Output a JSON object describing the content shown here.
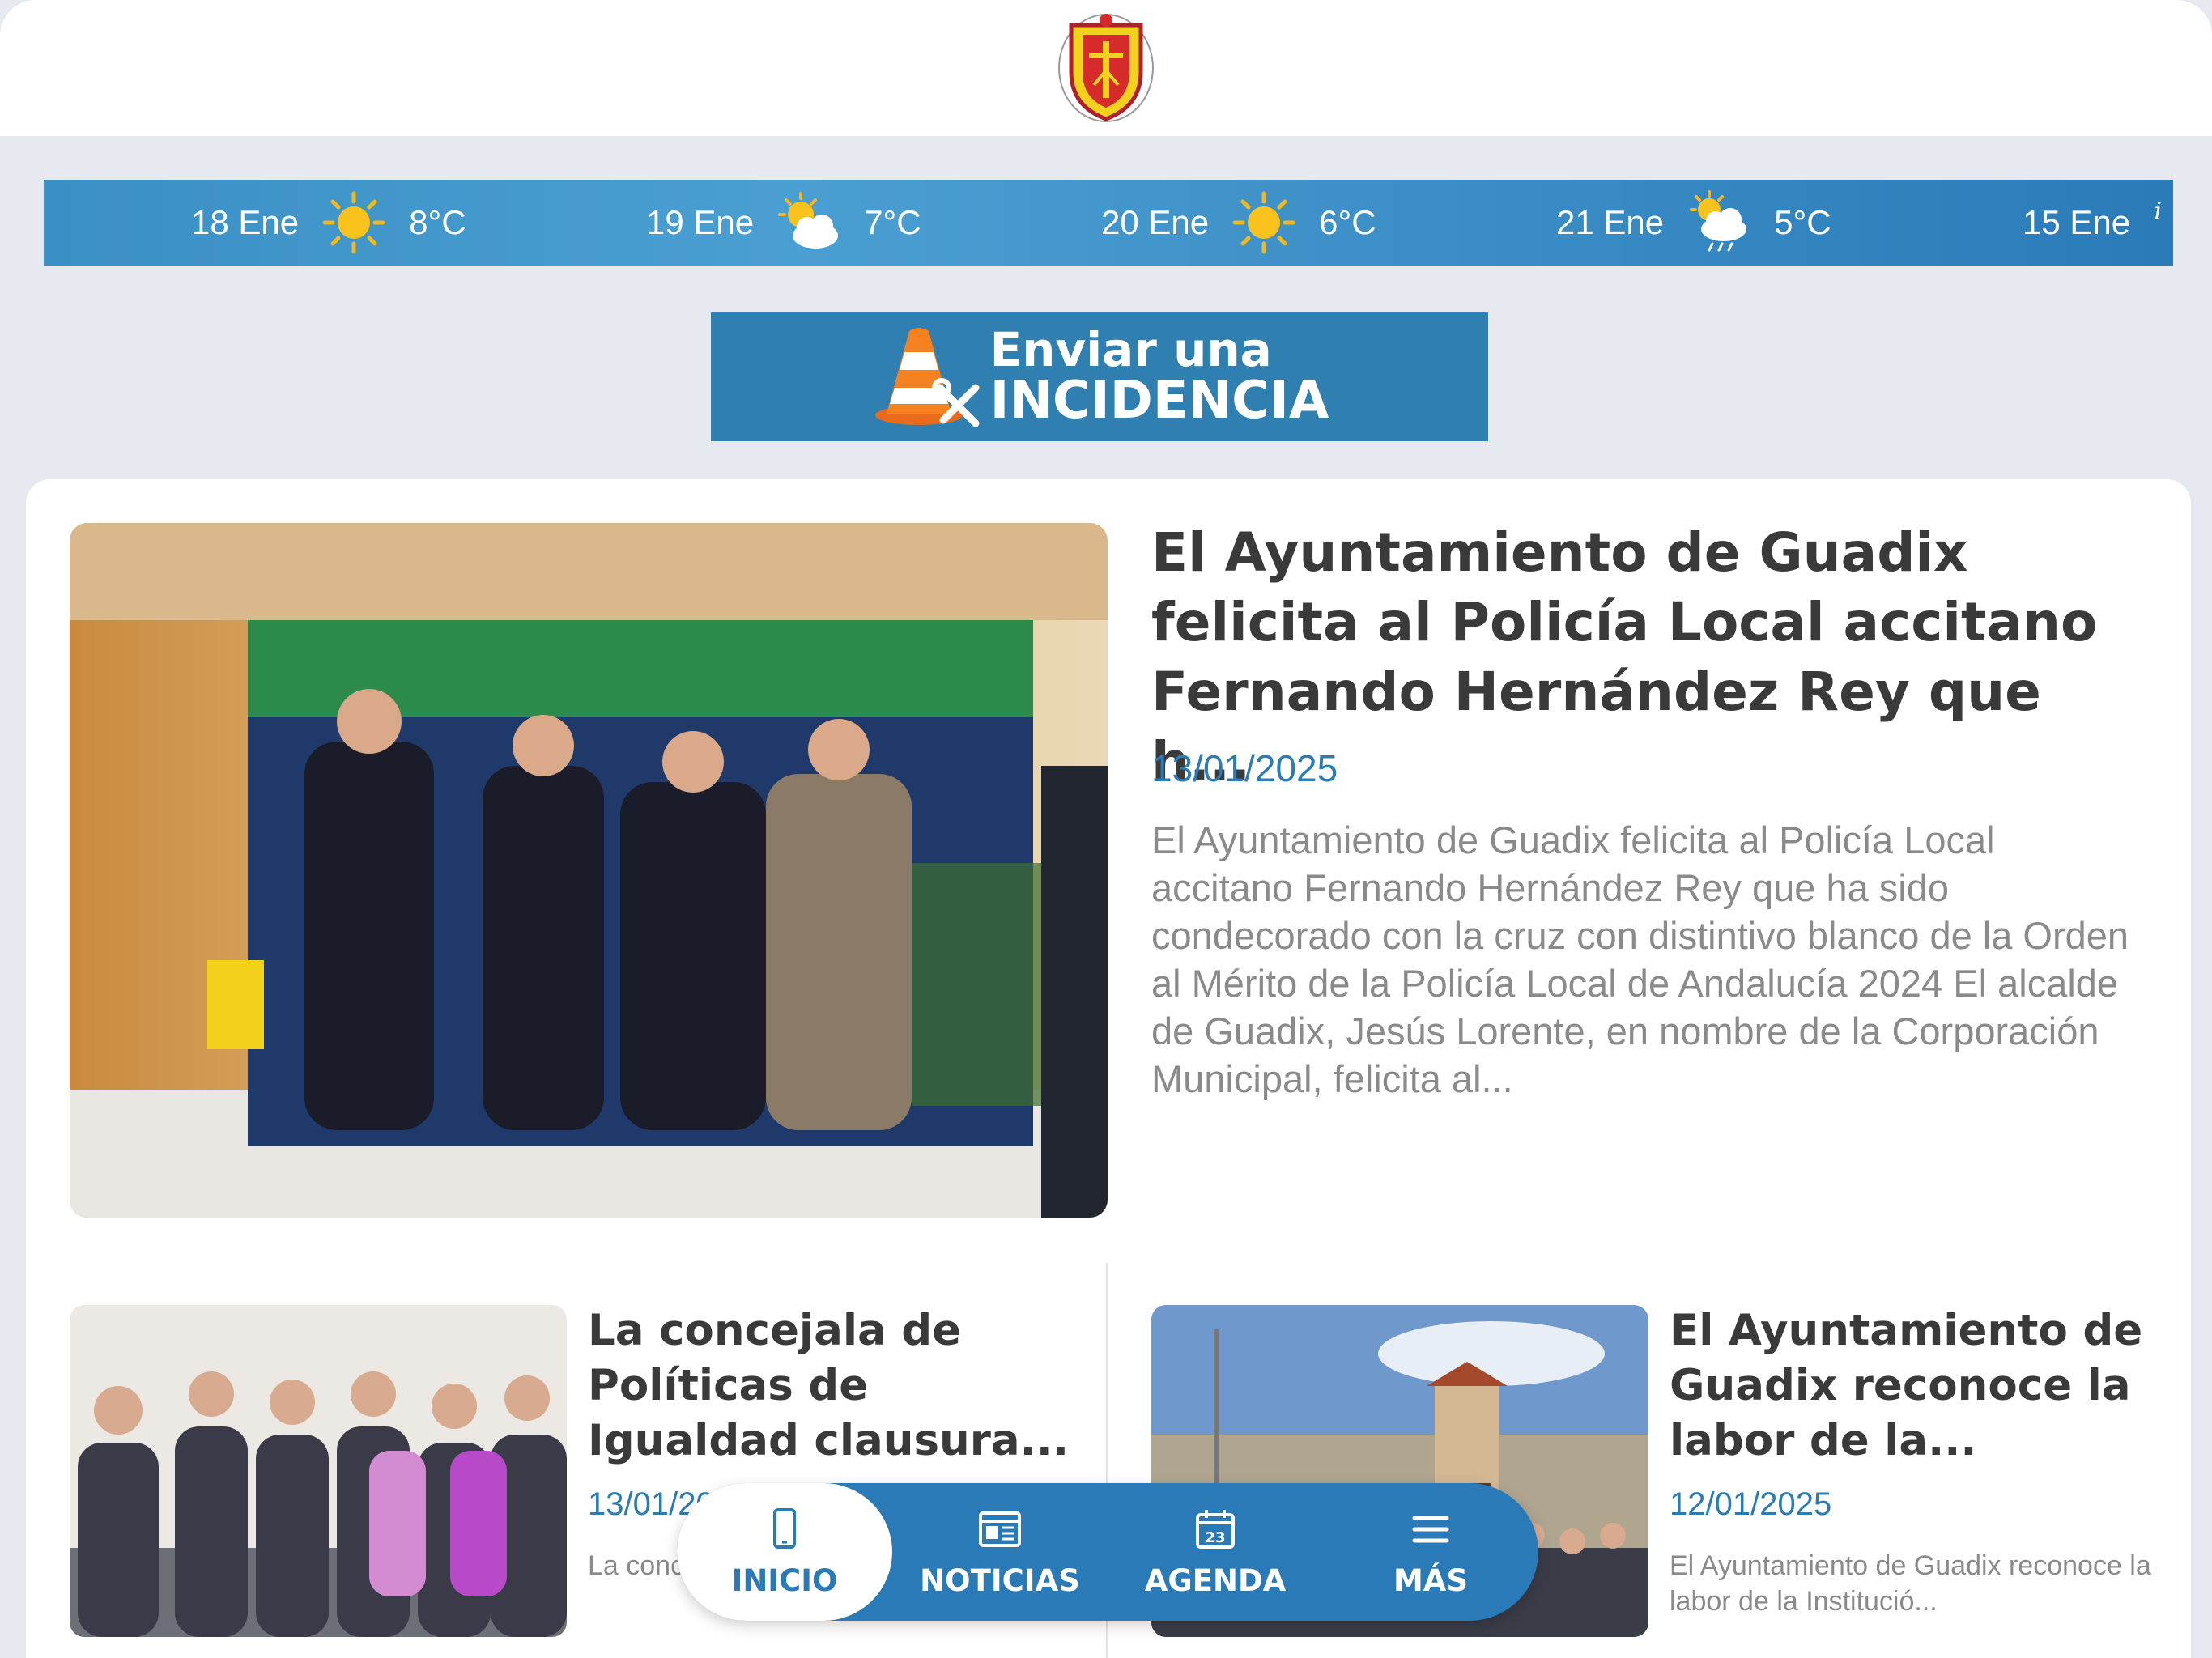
{
  "header": {
    "logo": "coat-of-arms-guadix"
  },
  "weather": {
    "days": [
      {
        "date": "18 Ene",
        "icon": "sun-icon",
        "temp": "8°C"
      },
      {
        "date": "19 Ene",
        "icon": "partly-cloudy-icon",
        "temp": "7°C"
      },
      {
        "date": "20 Ene",
        "icon": "sun-icon",
        "temp": "6°C"
      },
      {
        "date": "21 Ene",
        "icon": "cloud-rain-sun-icon",
        "temp": "5°C"
      },
      {
        "date": "15 Ene",
        "icon": "sun-icon",
        "temp": ""
      }
    ],
    "info_glyph": "i"
  },
  "incidencia": {
    "line1": "Enviar una",
    "line2": "INCIDENCIA"
  },
  "featured": {
    "title": "El Ayuntamiento de Guadix felicita al Policía Local accitano Fernando Hernández Rey que h...",
    "date": "13/01/2025",
    "summary": "El Ayuntamiento de Guadix felicita al Policía Local accitano Fernando Hernández Rey que ha sido condecorado con la cruz con distintivo blanco de la Orden al Mérito de la Policía Local de Andalucía 2024 El alcalde de Guadix, Jesús Lorente, en nombre de la Corporación Municipal, felicita al..."
  },
  "news": [
    {
      "title": "La concejala de Políticas de Igualdad clausura...",
      "date": "13/01/2025",
      "summary": "La concejala de Políticas de Igualdad..."
    },
    {
      "title": "El Ayuntamiento de Guadix reconoce la labor de la...",
      "date": "12/01/2025",
      "summary": "El Ayuntamiento de Guadix reconoce la labor de la Institució..."
    }
  ],
  "tabs": [
    {
      "label": "INICIO",
      "icon": "phone-icon"
    },
    {
      "label": "NOTICIAS",
      "icon": "newspaper-icon"
    },
    {
      "label": "AGENDA",
      "icon": "calendar-icon",
      "badge": "23"
    },
    {
      "label": "MÁS",
      "icon": "menu-icon"
    }
  ],
  "colors": {
    "accent": "#2a7ab7",
    "weather_bar": "#3a8fc4",
    "date": "#2b7bb5",
    "incidencia_bg": "#2f7fb0"
  }
}
